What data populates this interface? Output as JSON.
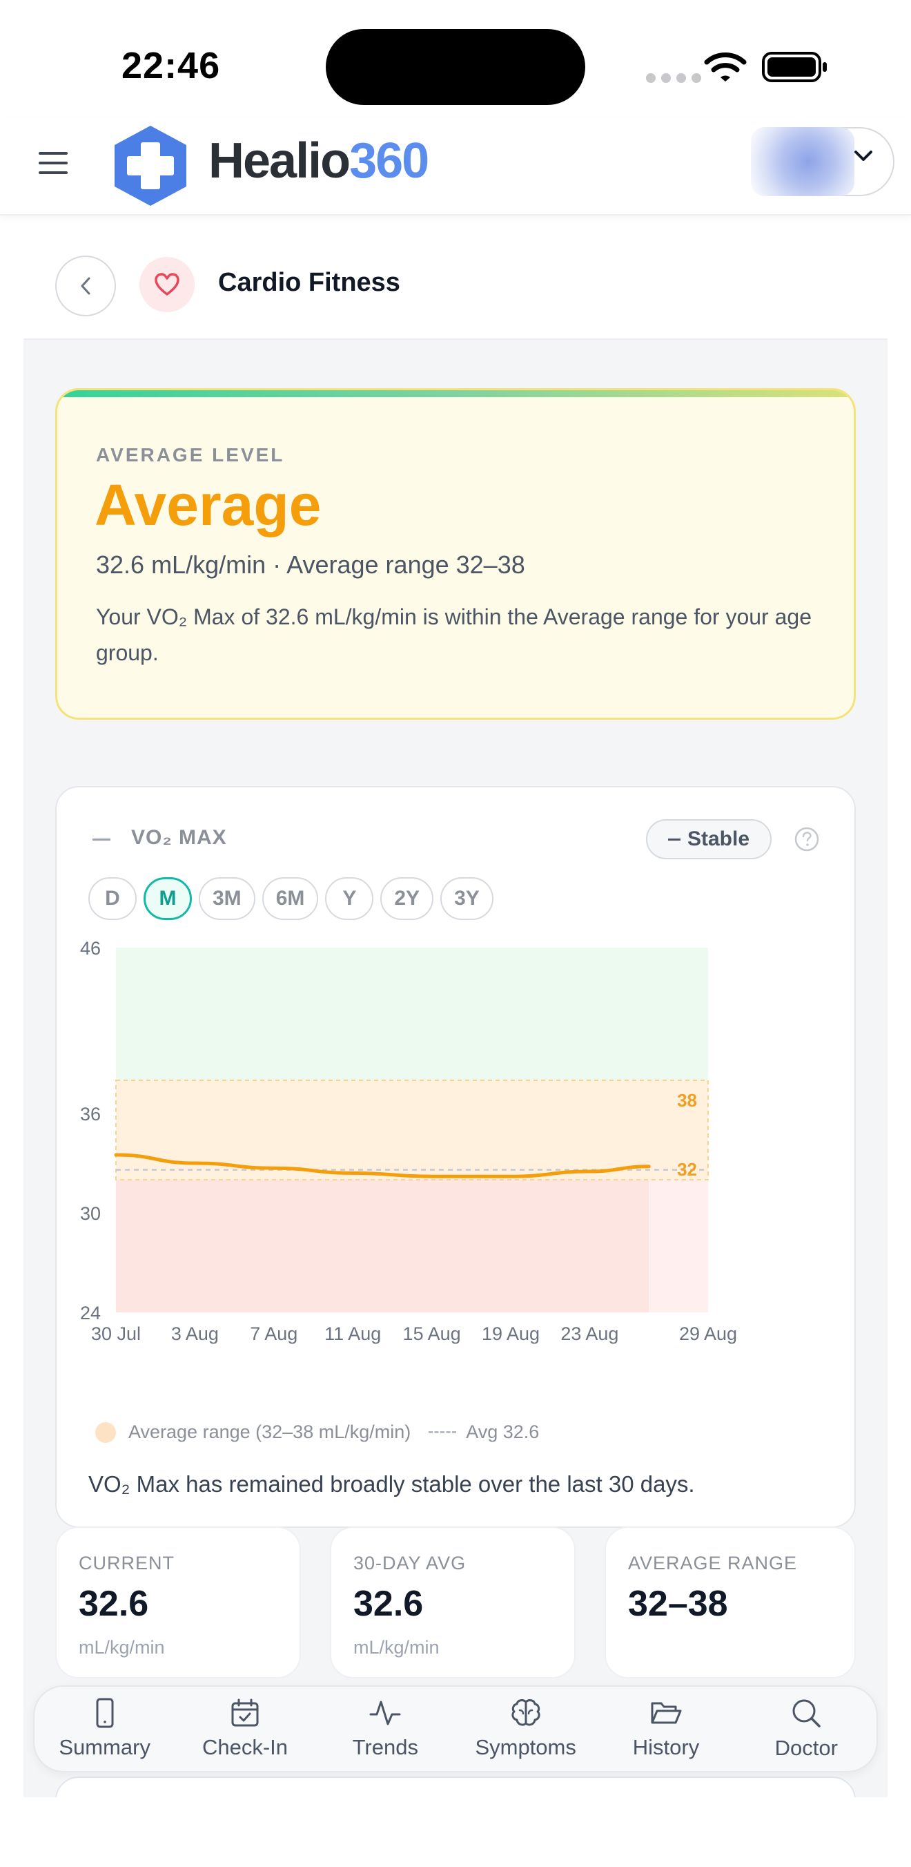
{
  "status_bar": {
    "time": "22:46"
  },
  "header": {
    "logo_word": "Healio",
    "logo_number": "360"
  },
  "sub_header": {
    "title": "Cardio Fitness"
  },
  "level_card": {
    "label": "AVERAGE LEVEL",
    "value": "Average",
    "subtitle": "32.6 mL/kg/min · Average range 32–38",
    "description": "Your VO₂ Max of 32.6 mL/kg/min is within the Average range for your age group."
  },
  "metric": {
    "title": "VO₂ MAX",
    "trend": "Stable",
    "ranges": [
      "D",
      "M",
      "3M",
      "6M",
      "Y",
      "2Y",
      "3Y"
    ],
    "active_range": "M"
  },
  "chart_data": {
    "type": "line",
    "x_ticks": [
      "30 Jul",
      "3 Aug",
      "7 Aug",
      "11 Aug",
      "15 Aug",
      "19 Aug",
      "23 Aug",
      "29 Aug"
    ],
    "y_ticks": [
      46,
      36,
      30,
      24
    ],
    "ylim": [
      24,
      46
    ],
    "x": [
      "30 Jul",
      "3 Aug",
      "7 Aug",
      "11 Aug",
      "15 Aug",
      "19 Aug",
      "23 Aug",
      "26 Aug"
    ],
    "y": [
      33.5,
      33.0,
      32.7,
      32.4,
      32.2,
      32.2,
      32.5,
      32.8
    ],
    "band": {
      "low": 32,
      "high": 38,
      "low_label": "32",
      "high_label": "38"
    },
    "avg_line": 32.6,
    "colors": {
      "line": "#f59e0b",
      "band": "#fde3c4",
      "above": "#ecfaef",
      "below": "#fde6e1"
    },
    "legend": {
      "band": "Average range (32–38 mL/kg/min)",
      "avg": "Avg 32.6"
    },
    "grid": false
  },
  "chart_summary": "VO₂ Max has remained broadly stable over the last 30 days.",
  "stats": [
    {
      "label": "CURRENT",
      "value": "32.6",
      "unit": "mL/kg/min"
    },
    {
      "label": "30-DAY AVG",
      "value": "32.6",
      "unit": "mL/kg/min"
    },
    {
      "label": "AVERAGE RANGE",
      "value": "32–38",
      "unit": ""
    }
  ],
  "nav": [
    {
      "label": "Summary",
      "icon": "phone-icon"
    },
    {
      "label": "Check-In",
      "icon": "calendar-check-icon"
    },
    {
      "label": "Trends",
      "icon": "pulse-icon"
    },
    {
      "label": "Symptoms",
      "icon": "brain-icon"
    },
    {
      "label": "History",
      "icon": "folder-open-icon"
    },
    {
      "label": "Doctor",
      "icon": "search-icon"
    }
  ]
}
